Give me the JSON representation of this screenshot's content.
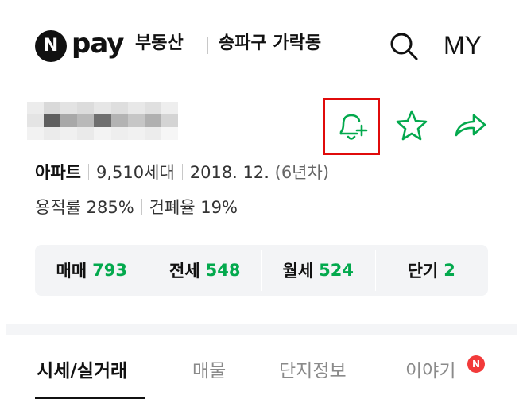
{
  "header": {
    "logo_letter": "N",
    "logo_text": "pay",
    "service_name": "부동산",
    "location": "송파구 가락동",
    "my_label": "MY",
    "search_icon": "search-icon"
  },
  "complex": {
    "name_blurred": true,
    "type": "아파트",
    "households": "9,510세대",
    "approval_date": "2018. 12.",
    "year_label": "(6년차)",
    "floor_area_ratio": "용적률 285%",
    "building_coverage_ratio": "건폐율 19%",
    "actions": [
      {
        "name": "alarm-add",
        "icon": "bell-plus-icon"
      },
      {
        "name": "favorite",
        "icon": "star-icon"
      },
      {
        "name": "share",
        "icon": "share-arrow-icon"
      }
    ]
  },
  "trade_types": [
    {
      "label": "매매",
      "count": "793"
    },
    {
      "label": "전세",
      "count": "548"
    },
    {
      "label": "월세",
      "count": "524"
    },
    {
      "label": "단기",
      "count": "2"
    }
  ],
  "tabs": [
    {
      "label": "시세/실거래",
      "active": true
    },
    {
      "label": "매물",
      "active": false
    },
    {
      "label": "단지정보",
      "active": false
    },
    {
      "label": "이야기",
      "active": false,
      "badge": "N"
    }
  ],
  "colors": {
    "accent_green": "#03a94d",
    "highlight_red": "#e00b0b",
    "badge_red": "#f23a3a"
  }
}
